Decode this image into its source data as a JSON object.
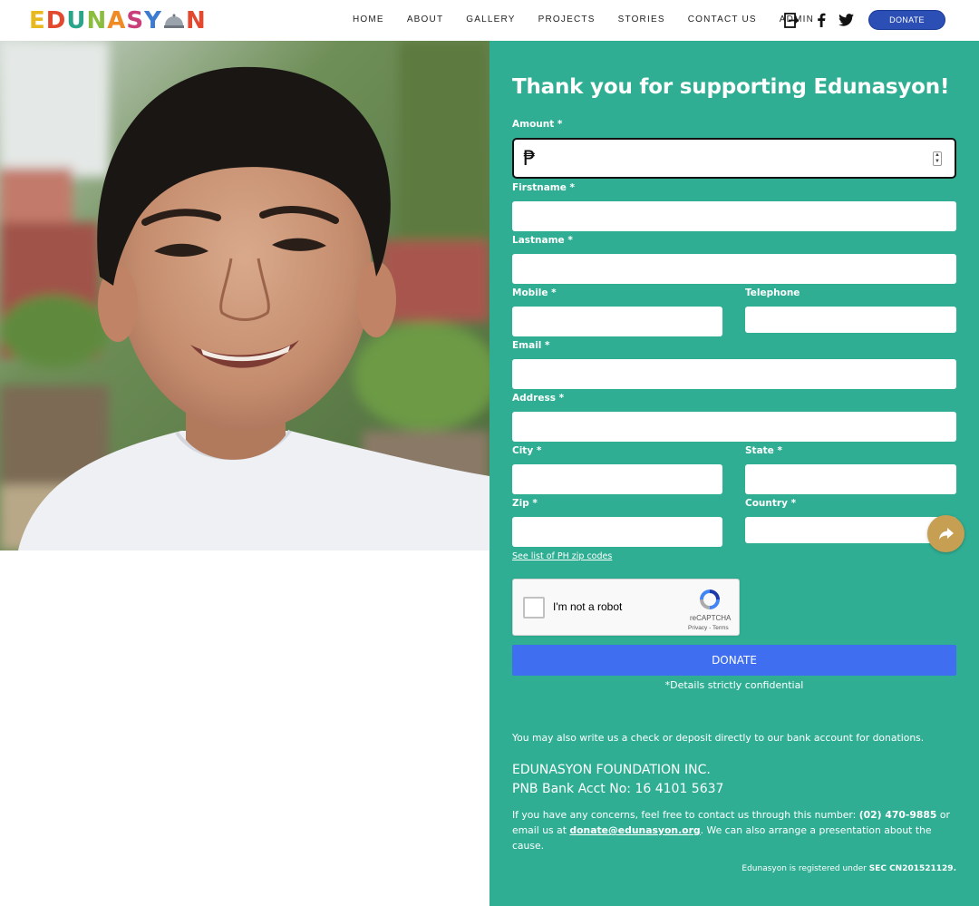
{
  "header": {
    "logo_text": "EDUNASYON",
    "nav": [
      "HOME",
      "ABOUT",
      "GALLERY",
      "PROJECTS",
      "STORIES",
      "CONTACT US",
      "ADMIN"
    ],
    "icons": [
      "login-icon",
      "facebook-icon",
      "twitter-icon"
    ],
    "donate_label": "DONATE"
  },
  "form": {
    "title": "Thank you for supporting Edunasyon!",
    "amount_label": "Amount *",
    "currency_symbol": "₱",
    "firstname_label": "Firstname *",
    "lastname_label": "Lastname *",
    "mobile_label": "Mobile *",
    "telephone_label": "Telephone",
    "email_label": "Email *",
    "address_label": "Address *",
    "city_label": "City *",
    "state_label": "State *",
    "zip_label": "Zip *",
    "country_label": "Country *",
    "zip_link": "See list of PH zip codes",
    "captcha": {
      "label": "I'm not a robot",
      "brand": "reCAPTCHA",
      "terms": "Privacy - Terms"
    },
    "donate_button": "DONATE",
    "confidential": "*Details strictly confidential"
  },
  "info": {
    "check_text": "You may also write us a check or deposit directly to our bank account for donations.",
    "org_name": "EDUNASYON FOUNDATION INC.",
    "bank_acct": "PNB Bank Acct No: 16 4101 5637",
    "contact_pre": "If you have any concerns, feel free to contact us through this number: ",
    "contact_phone": "(02) 470-9885",
    "contact_mid": " or email us at ",
    "contact_email": "donate@edunasyon.org",
    "contact_post": ". We can also arrange a presentation about the cause.",
    "sec_pre": "Edunasyon is registered under ",
    "sec_no": "SEC CN201521129."
  },
  "colors": {
    "panel": "#2fae93",
    "donate_button": "#3f6ff0",
    "header_donate": "#2c4fb6",
    "share_fab": "#c79f52"
  }
}
